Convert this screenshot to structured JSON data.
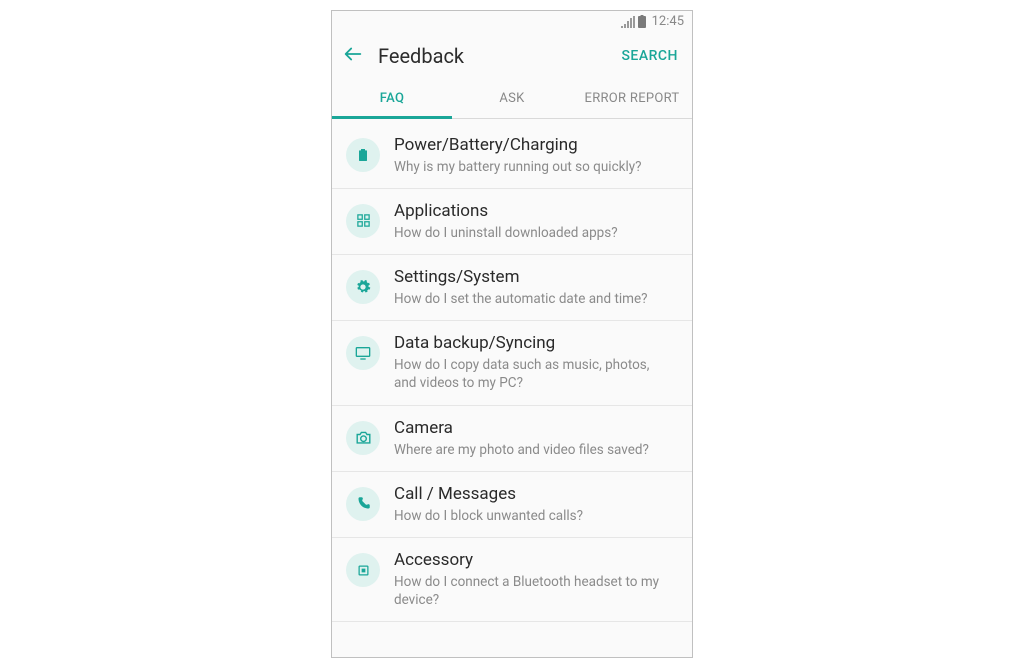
{
  "statusbar": {
    "time": "12:45"
  },
  "header": {
    "title": "Feedback",
    "search": "SEARCH"
  },
  "tabs": [
    {
      "label": "FAQ",
      "active": true
    },
    {
      "label": "ASK",
      "active": false
    },
    {
      "label": "ERROR REPORT",
      "active": false
    }
  ],
  "faq": [
    {
      "icon": "battery-icon",
      "title": "Power/Battery/Charging",
      "sub": "Why is my battery running out so quickly?"
    },
    {
      "icon": "apps-icon",
      "title": "Applications",
      "sub": "How do I uninstall downloaded apps?"
    },
    {
      "icon": "gear-icon",
      "title": "Settings/System",
      "sub": "How do I set the automatic date and time?"
    },
    {
      "icon": "monitor-icon",
      "title": "Data backup/Syncing",
      "sub": "How do I copy data such as music, photos, and videos to my PC?"
    },
    {
      "icon": "camera-icon",
      "title": "Camera",
      "sub": "Where are my photo and video files saved?"
    },
    {
      "icon": "phone-icon",
      "title": "Call / Messages",
      "sub": "How do I block unwanted calls?"
    },
    {
      "icon": "chip-icon",
      "title": "Accessory",
      "sub": "How do I connect a Bluetooth headset to my device?"
    }
  ]
}
